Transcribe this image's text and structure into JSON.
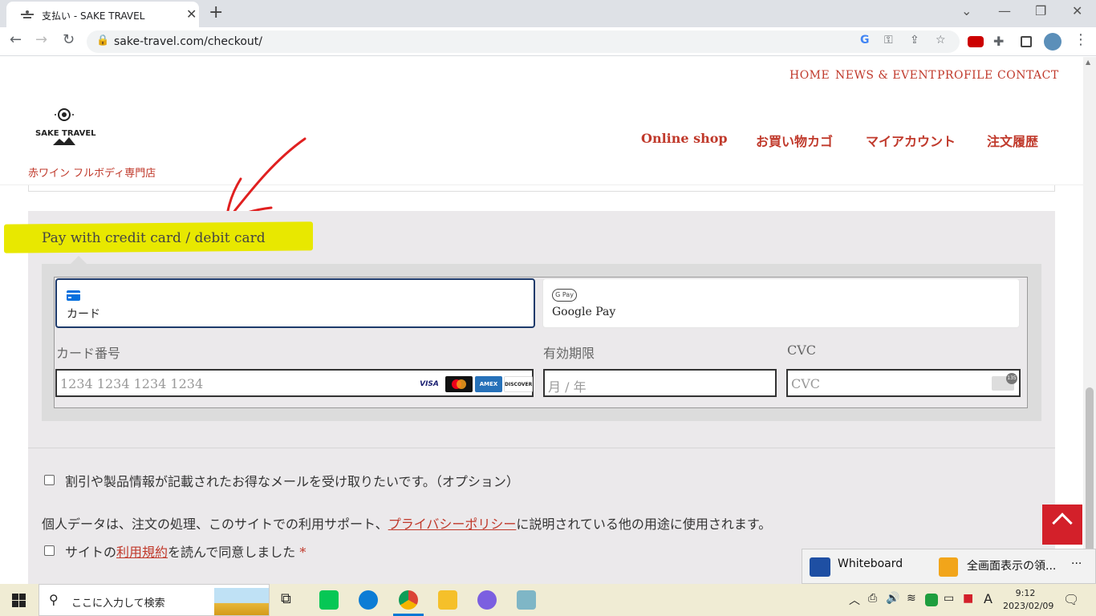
{
  "browser": {
    "tab_title": "支払い - SAKE TRAVEL",
    "url": "sake-travel.com/checkout/"
  },
  "site": {
    "top_nav": [
      "HOME",
      "NEWS & EVENT",
      "PROFILE",
      "CONTACT"
    ],
    "main_nav": [
      "Online shop",
      "お買い物カゴ",
      "マイアカウント",
      "注文履歴"
    ],
    "logo_text": "SAKE TRAVEL",
    "tagline": "赤ワイン フルボディ専門店"
  },
  "payment": {
    "title": "Pay with credit card / debit card",
    "methods": [
      {
        "label": "カード",
        "selected": true
      },
      {
        "label": "Google Pay",
        "badge": "G Pay",
        "selected": false
      }
    ],
    "card_number_label": "カード番号",
    "card_number_placeholder": "1234 1234 1234 1234",
    "expiry_label": "有効期限",
    "expiry_placeholder": "月 / 年",
    "cvc_label": "CVC",
    "cvc_placeholder": "CVC",
    "cvc_badge": "135",
    "card_brands": [
      "VISA",
      "Mastercard",
      "AMEX",
      "DISCOVER"
    ]
  },
  "consent": {
    "newsletter": "割引や製品情報が記載されたお得なメールを受け取りたいです。（オプション）",
    "privacy_prefix": "個人データは、注文の処理、このサイトでの利用サポート、",
    "privacy_link": "プライバシーポリシー",
    "privacy_suffix": "に説明されている他の用途に使用されます。",
    "terms_prefix": "サイトの",
    "terms_link": "利用規約",
    "terms_suffix": "を読んで同意しました",
    "required_mark": "*"
  },
  "notification": {
    "items": [
      "Whiteboard",
      "全画面表示の領..."
    ],
    "more": "···"
  },
  "taskbar": {
    "search_placeholder": "ここに入力して検索",
    "time": "9:12",
    "date": "2023/02/09",
    "ime": "A"
  },
  "colors": {
    "brand_red": "#c0392b",
    "highlight": "#e8e800",
    "selected_border": "#1d3a6b"
  }
}
